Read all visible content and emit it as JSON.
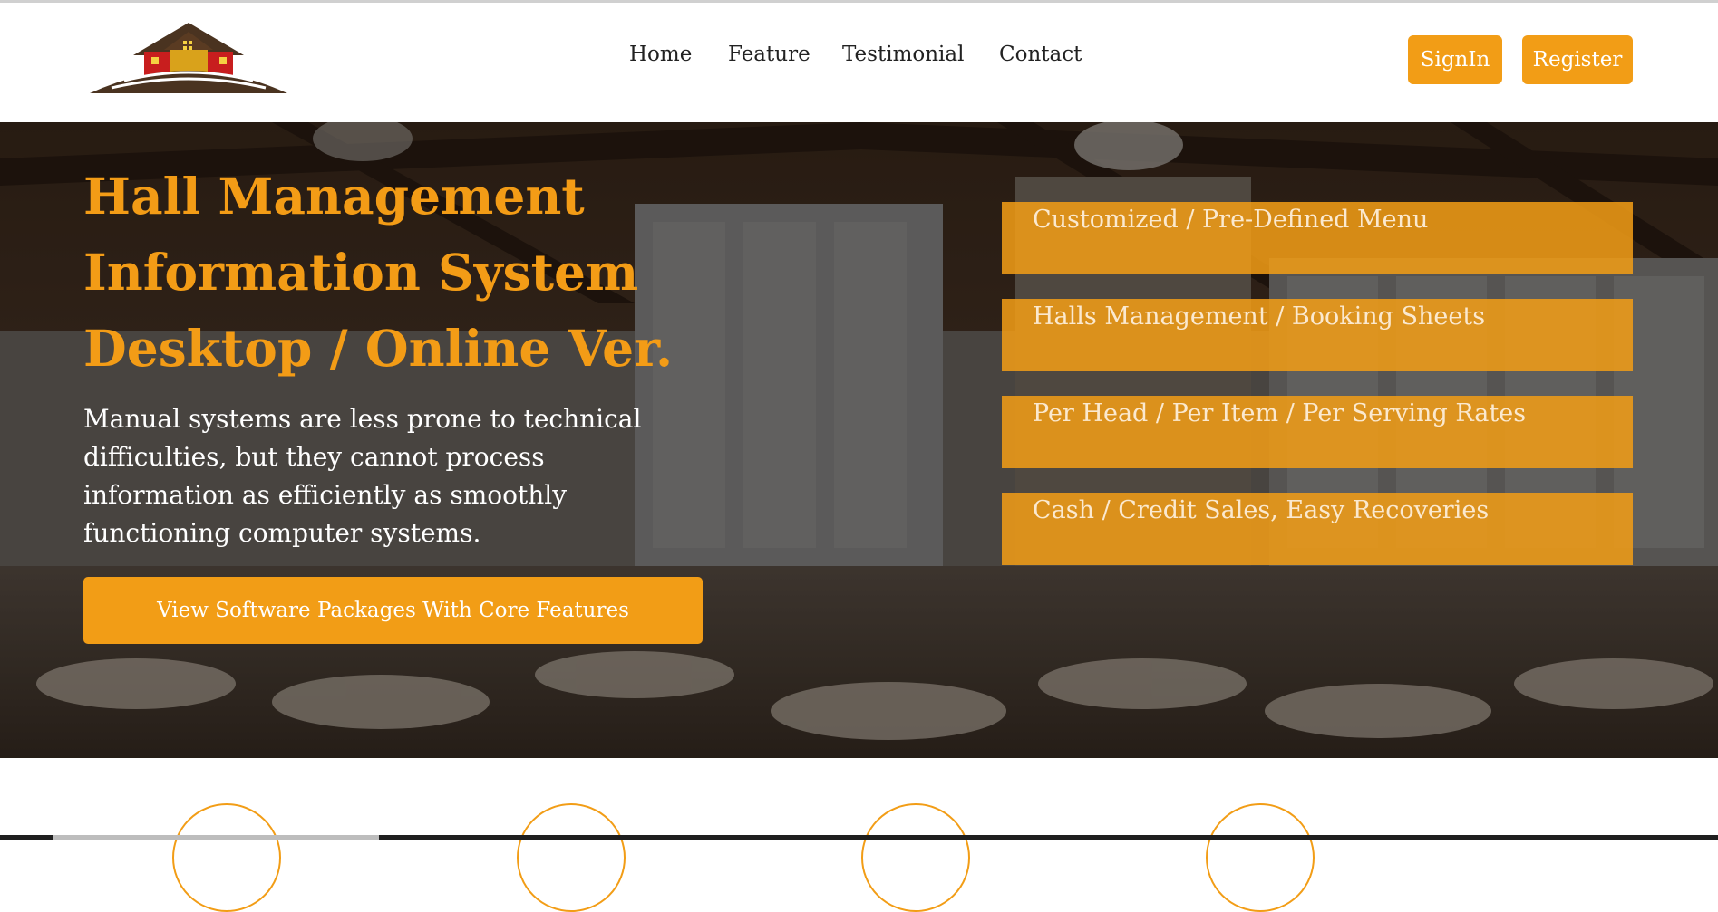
{
  "header": {
    "logo_icon": "house-on-hill-logo",
    "nav": [
      "Home",
      "Feature",
      "Testimonial",
      "Contact"
    ],
    "signin_label": "SignIn",
    "register_label": "Register"
  },
  "hero": {
    "title_lines": [
      "Hall Management",
      "Information System",
      "Desktop / Online Ver."
    ],
    "description": "Manual systems are less prone to technical difficulties, but they cannot process information as efficiently as smoothly functioning computer systems.",
    "cta_label": "View Software Packages With Core Features",
    "features": [
      "Customized / Pre-Defined Menu",
      "Halls Management / Booking Sheets",
      "Per Head / Per Item / Per Serving Rates",
      "Cash / Credit Sales, Easy Recoveries"
    ]
  },
  "colors": {
    "accent": "#f29d16",
    "title": "#f39c16",
    "nav_text": "#222222"
  }
}
